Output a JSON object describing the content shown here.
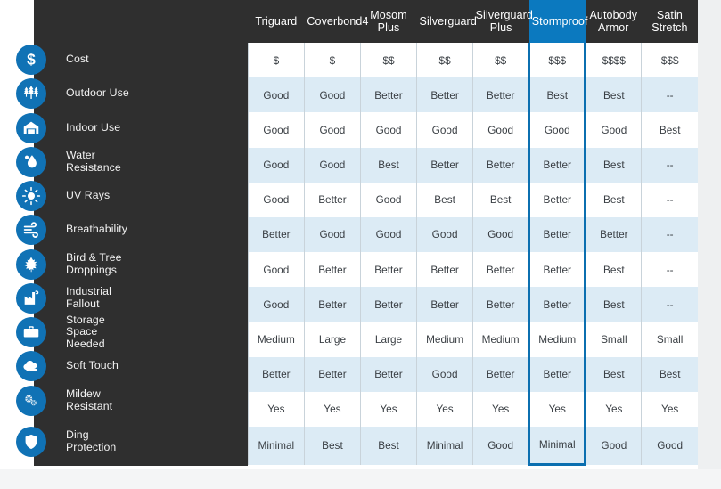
{
  "theme": {
    "sidebar_bg": "#2f2f2f",
    "accent": "#1072b5",
    "highlight_header_bg": "#0b79bf",
    "highlight_border": "#0b6fb0",
    "row_alt_bg": "#dcebf5",
    "cell_border": "#c9d3da",
    "text_dark": "#3a3f44"
  },
  "header": {
    "label_column": "",
    "products": [
      {
        "name": "Triguard",
        "highlighted": false
      },
      {
        "name": "Coverbond4",
        "highlighted": false
      },
      {
        "name": "Mosom\nPlus",
        "highlighted": false
      },
      {
        "name": "Silverguard",
        "highlighted": false
      },
      {
        "name": "Silverguard\nPlus",
        "highlighted": false
      },
      {
        "name": "Stormproof",
        "highlighted": true
      },
      {
        "name": "Autobody\nArmor",
        "highlighted": false
      },
      {
        "name": "Satin\nStretch",
        "highlighted": false
      }
    ]
  },
  "rows": [
    {
      "label": "Cost",
      "icon": "dollar-icon",
      "values": [
        "$",
        "$",
        "$$",
        "$$",
        "$$",
        "$$$",
        "$$$$",
        "$$$"
      ]
    },
    {
      "label": "Outdoor Use",
      "icon": "trees-icon",
      "values": [
        "Good",
        "Good",
        "Better",
        "Better",
        "Better",
        "Best",
        "Best",
        "--"
      ]
    },
    {
      "label": "Indoor Use",
      "icon": "garage-icon",
      "values": [
        "Good",
        "Good",
        "Good",
        "Good",
        "Good",
        "Good",
        "Good",
        "Best"
      ]
    },
    {
      "label": "Water\nResistance",
      "icon": "water-drop-icon",
      "values": [
        "Good",
        "Good",
        "Best",
        "Better",
        "Better",
        "Better",
        "Best",
        "--"
      ]
    },
    {
      "label": "UV Rays",
      "icon": "sun-icon",
      "values": [
        "Good",
        "Better",
        "Good",
        "Best",
        "Best",
        "Better",
        "Best",
        "--"
      ]
    },
    {
      "label": "Breathability",
      "icon": "airflow-icon",
      "values": [
        "Better",
        "Good",
        "Good",
        "Good",
        "Good",
        "Better",
        "Better",
        "--"
      ]
    },
    {
      "label": "Bird & Tree\nDroppings",
      "icon": "leaf-icon",
      "values": [
        "Good",
        "Better",
        "Better",
        "Better",
        "Better",
        "Better",
        "Best",
        "--"
      ]
    },
    {
      "label": "Industrial\nFallout",
      "icon": "factory-icon",
      "values": [
        "Good",
        "Better",
        "Better",
        "Better",
        "Better",
        "Better",
        "Best",
        "--"
      ]
    },
    {
      "label": "Storage\nSpace\nNeeded",
      "icon": "briefcase-icon",
      "values": [
        "Medium",
        "Large",
        "Large",
        "Medium",
        "Medium",
        "Medium",
        "Small",
        "Small"
      ]
    },
    {
      "label": "Soft Touch",
      "icon": "cloud-icon",
      "values": [
        "Better",
        "Better",
        "Better",
        "Good",
        "Better",
        "Better",
        "Best",
        "Best"
      ]
    },
    {
      "label": "Mildew\nResistant",
      "icon": "spores-icon",
      "values": [
        "Yes",
        "Yes",
        "Yes",
        "Yes",
        "Yes",
        "Yes",
        "Yes",
        "Yes"
      ]
    },
    {
      "label": "Ding\nProtection",
      "icon": "shield-icon",
      "values": [
        "Minimal",
        "Best",
        "Best",
        "Minimal",
        "Good",
        "Minimal",
        "Good",
        "Good"
      ]
    }
  ]
}
